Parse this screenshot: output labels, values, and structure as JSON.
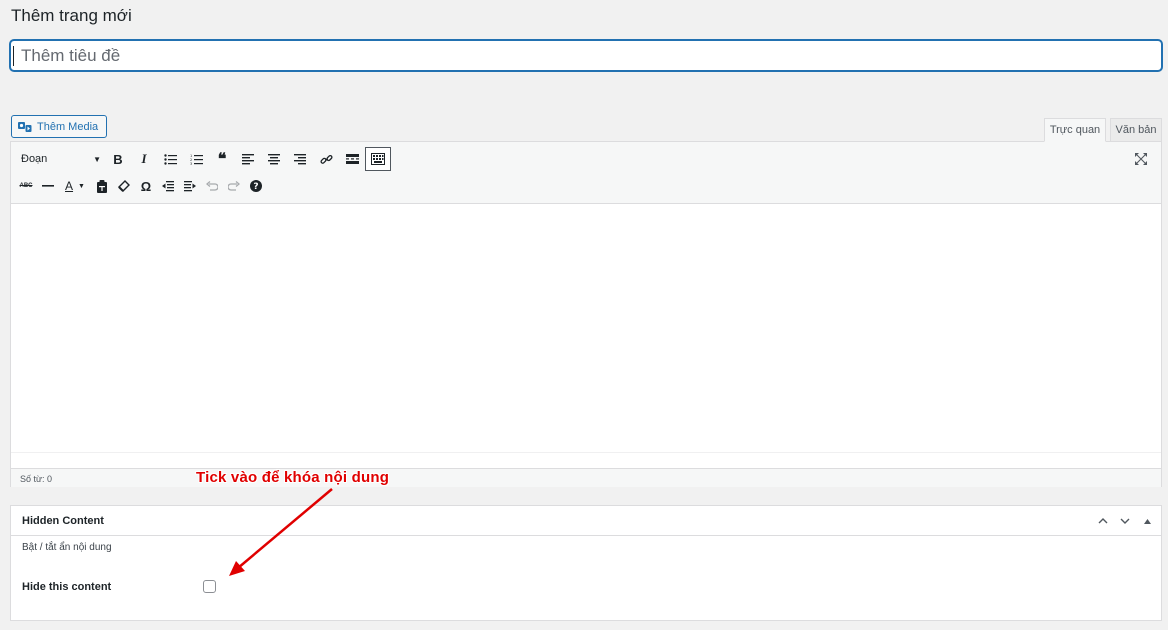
{
  "page": {
    "title": "Thêm trang mới"
  },
  "title_field": {
    "placeholder": "Thêm tiêu đề"
  },
  "media": {
    "button_label": "Thêm Media"
  },
  "editor": {
    "tabs": {
      "visual": "Trực quan",
      "text": "Văn bản"
    },
    "format_select": "Đoạn",
    "word_count": "Số từ: 0"
  },
  "metabox": {
    "title": "Hidden Content",
    "description": "Bật / tắt ẩn nội dung",
    "checkbox_label": "Hide this content",
    "checkbox_checked": false
  },
  "annotation": {
    "text": "Tick vào để khóa nội dung",
    "color": "#e00000"
  },
  "colors": {
    "accent": "#2271b1",
    "background": "#f1f1f1"
  }
}
